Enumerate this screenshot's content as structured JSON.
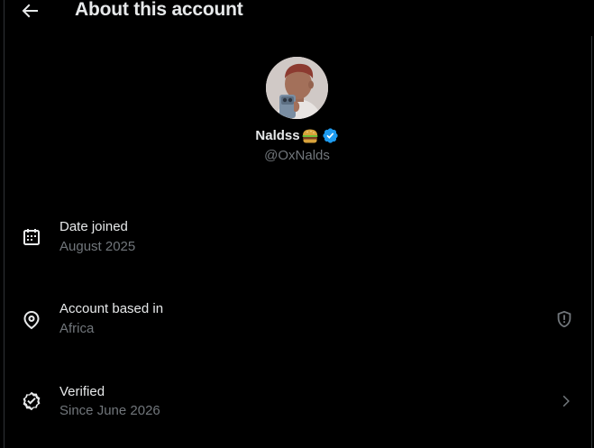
{
  "header": {
    "title": "About this account",
    "back_icon": "arrow-left-icon"
  },
  "profile": {
    "display_name": "Naldss",
    "name_emoji_icon": "burger-emoji-icon",
    "verified_icon": "verified-badge-icon",
    "handle": "@OxNalds"
  },
  "items": [
    {
      "icon": "calendar-icon",
      "label": "Date joined",
      "value": "August 2025",
      "trailing_icon": ""
    },
    {
      "icon": "location-pin-icon",
      "label": "Account based in",
      "value": "Africa",
      "trailing_icon": "shield-alert-icon"
    },
    {
      "icon": "verified-check-icon",
      "label": "Verified",
      "value": "Since June 2026",
      "trailing_icon": "chevron-right-icon"
    }
  ],
  "colors": {
    "background": "#000000",
    "primary_text": "#e7e9ea",
    "secondary_text": "#71767b",
    "verified_blue": "#1d9bf0",
    "border": "#2f3336"
  }
}
